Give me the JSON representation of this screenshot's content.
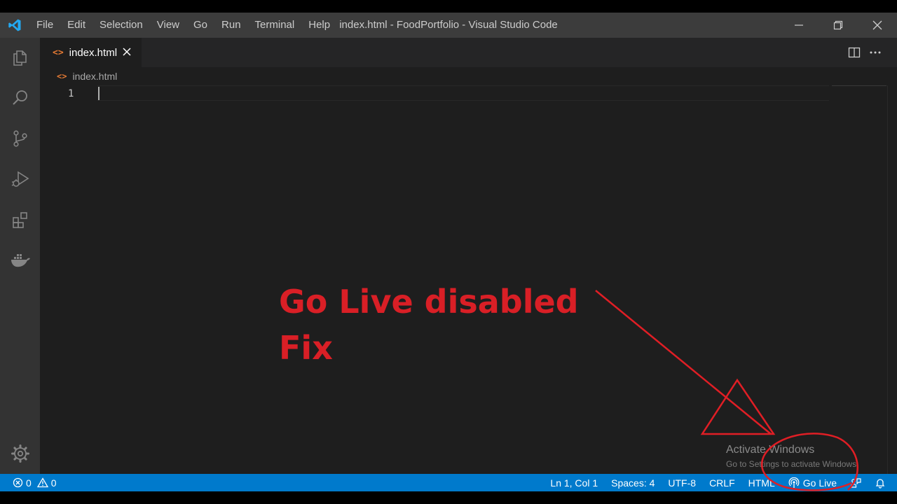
{
  "window": {
    "title": "index.html - FoodPortfolio - Visual Studio Code"
  },
  "menu": [
    "File",
    "Edit",
    "Selection",
    "View",
    "Go",
    "Run",
    "Terminal",
    "Help"
  ],
  "activity_bar": {
    "icons": [
      "explorer-icon",
      "search-icon",
      "source-control-icon",
      "run-debug-icon",
      "extensions-icon",
      "docker-icon",
      "settings-gear-icon"
    ]
  },
  "tab": {
    "label": "index.html",
    "icon": "<>"
  },
  "breadcrumb": {
    "icon": "<>",
    "label": "index.html"
  },
  "editor": {
    "line_numbers": [
      "1"
    ],
    "text": ""
  },
  "overlay": {
    "line1": "Go Live disabled",
    "line2": "Fix",
    "color": "#d91f26"
  },
  "watermark": {
    "title": "Activate Windows",
    "subtitle": "Go to Settings to activate Windows."
  },
  "statusbar": {
    "errors": "0",
    "warnings": "0",
    "position": "Ln 1, Col 1",
    "spaces": "Spaces: 4",
    "encoding": "UTF-8",
    "eol": "CRLF",
    "language": "HTML",
    "golive": "Go Live",
    "color": "#007acc"
  }
}
